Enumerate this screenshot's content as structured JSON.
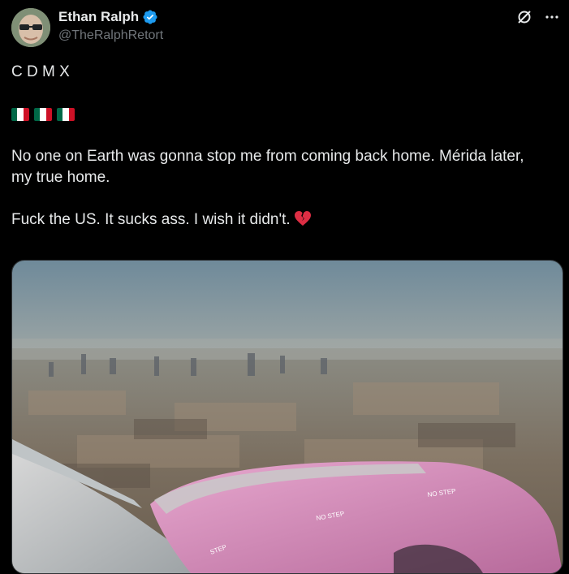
{
  "author": {
    "display_name": "Ethan Ralph",
    "handle": "@TheRalphRetort",
    "verified": true
  },
  "tweet": {
    "line1": "C D M X",
    "flags": [
      "mexico-flag",
      "mexico-flag",
      "mexico-flag"
    ],
    "para1": "No one on Earth was gonna stop me from coming back home. Mérida later, my true home.",
    "para2": "Fuck the US. It sucks ass. I wish it didn't.",
    "para2_emoji": "broken-heart"
  },
  "media": {
    "description_labels": [
      "NO STEP",
      "NO STEP",
      "STEP"
    ]
  },
  "colors": {
    "accent": "#1d9bf0",
    "text": "#e7e9ea",
    "muted": "#71767b",
    "background": "#000000"
  },
  "icons": [
    "verified-badge-icon",
    "grok-icon",
    "more-icon"
  ]
}
